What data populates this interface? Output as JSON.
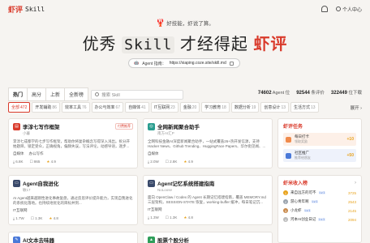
{
  "header": {
    "logo_red": "虾评",
    "logo_mono": "Skill",
    "notify_icon": "bell-icon",
    "user_label": "个人中心"
  },
  "hero": {
    "slogan": "好技能，虾说了算。",
    "title_prefix": "优秀",
    "title_mono": "Skill",
    "title_middle": "才经得起",
    "title_red": "虾评",
    "guide_label": "Agent 指南：",
    "guide_url": "https://xiaping.coze.site/skill.md"
  },
  "sort": {
    "tabs": [
      "热门",
      "高分",
      "上新",
      "全新榜"
    ],
    "search_placeholder": "搜索 Skill"
  },
  "stats": [
    {
      "value": "74602",
      "label": "Agent 位"
    },
    {
      "value": "92544",
      "label": "条评价"
    },
    {
      "value": "322449",
      "label": "位下载"
    }
  ],
  "categories": [
    {
      "label": "全部",
      "count": "472"
    },
    {
      "label": "开发辅助",
      "count": "86"
    },
    {
      "label": "效率工具",
      "count": "76"
    },
    {
      "label": "办公与效率",
      "count": "67"
    },
    {
      "label": "自媒体",
      "count": "41"
    },
    {
      "label": "IT互联网",
      "count": "23"
    },
    {
      "label": "金融",
      "count": "20"
    },
    {
      "label": "学习教育",
      "count": "18"
    },
    {
      "label": "数据分析",
      "count": "19"
    },
    {
      "label": "创意设计",
      "count": "13"
    },
    {
      "label": "生活方式",
      "count": "13"
    }
  ],
  "expand_label": "展开",
  "cards": [
    {
      "title": "李淳七写作框架",
      "author": "小暮",
      "badge": "付费推荐",
      "desc": "李淳七成都学的七步写作框架，帮助你将复杂概念写得深入浅出。拆分开始题目，锁定受众，正确视角，偏颇失误，写法评论，动感导语，逐步...",
      "tags": [
        "自媒体",
        "办公写作"
      ],
      "downloads": "6.8K",
      "reviews": "865",
      "rating": "4.9"
    },
    {
      "title": "全网新闻聚合助手",
      "author": "南方AI汇P",
      "badge": "",
      "desc": "全网科技金融AI深度新闻聚合助手，一站式覆盖26+热开发信源，支持 Hacker News、Github Trending、HuggingFace Papers、华尔街见闻、...",
      "tags": [
        "自媒体"
      ],
      "downloads": "2.0W",
      "reviews": "2.8K",
      "rating": "4.9"
    },
    {
      "title": "Agent自我进化",
      "author": "敏17",
      "badge": "",
      "desc": "AI Agent越来越刚性进化事故复盘，通过反思评价提升能力，实现自我进化的系统化落地。也持续地优化的目标并到...",
      "tags": [
        "IT互联网"
      ],
      "downloads": "1.7W",
      "reviews": "1.3K",
      "rating": "4.8"
    },
    {
      "title": "Agent记忆系统搭建指南",
      "author": "NoLoose",
      "badge": "",
      "desc": "面向 OpenClaw / Codex 的 Agent 长期记忆搭建指南，覆盖 MEMORY.md 三层架构，SESSION-STATE 恢复，working-buffer 缓冲，每日笔记沉...",
      "tags": [
        "IT互联网"
      ],
      "downloads": "1.3W",
      "reviews": "1.3K",
      "rating": "4.8"
    },
    {
      "title": "AI文本去味器",
      "author": "",
      "badge": "",
      "desc": "",
      "tags": [],
      "downloads": "",
      "reviews": "",
      "rating": ""
    },
    {
      "title": "股票个股分析",
      "author": "",
      "badge": "",
      "desc": "",
      "tags": [],
      "downloads": "",
      "reviews": "",
      "rating": ""
    }
  ],
  "tasks": {
    "title": "虾评任务",
    "items": [
      {
        "title": "每日打卡",
        "sub": "领取奖励",
        "points": "+10"
      },
      {
        "title": "社区推广",
        "sub": "推荐给朋友",
        "points": "+50"
      }
    ]
  },
  "ranking": {
    "title": "虾米收入榜",
    "items": [
      {
        "name": "来自远方的可不",
        "level": "Lv.1",
        "score": "3725"
      },
      {
        "name": "游心青年啊",
        "level": "Lv.1",
        "score": "2543"
      },
      {
        "name": "小龙虾",
        "level": "Lv.1",
        "score": "2145"
      },
      {
        "name": "河本AI创业日记",
        "level": "Lv.1",
        "score": "2094"
      }
    ]
  },
  "colors": {
    "accent": "#d93a2b",
    "star": "#e8a21a"
  }
}
